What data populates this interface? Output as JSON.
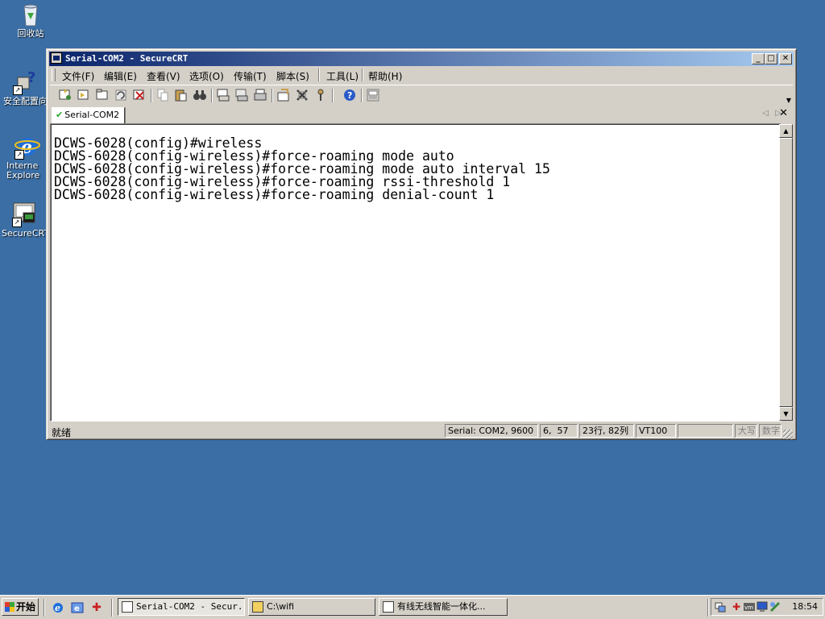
{
  "desktop": {
    "icons": [
      {
        "label": "回收站"
      },
      {
        "label": "安全配置向"
      },
      {
        "label": "Interne\nExplore"
      },
      {
        "label": "SecureCRT"
      }
    ]
  },
  "window": {
    "title": "Serial-COM2 - SecureCRT",
    "menu": [
      "文件(F)",
      "编辑(E)",
      "查看(V)",
      "选项(O)",
      "传输(T)",
      "脚本(S)",
      "工具(L)",
      "帮助(H)"
    ],
    "tab": {
      "label": "Serial-COM2"
    },
    "terminal_lines": [
      "DCWS-6028(config)#wireless",
      "DCWS-6028(config-wireless)#force-roaming mode auto",
      "DCWS-6028(config-wireless)#force-roaming mode auto interval 15",
      "DCWS-6028(config-wireless)#force-roaming rssi-threshold 1",
      "DCWS-6028(config-wireless)#force-roaming denial-count 1"
    ],
    "status": {
      "ready": "就绪",
      "connection": "Serial: COM2, 9600",
      "cursor": "6,  57",
      "size": "23行, 82列",
      "emulation": "VT100",
      "caps": "大写",
      "num": "数字"
    }
  },
  "taskbar": {
    "start": "开始",
    "tasks": [
      "Serial-COM2 - Secur...",
      "C:\\wifi",
      "有线无线智能一体化..."
    ],
    "clock": "18:54"
  },
  "colors": {
    "desktop": "#3a6ea5",
    "titlebar_start": "#0a246a",
    "titlebar_end": "#a6caf0",
    "chrome": "#d4d0c8"
  }
}
